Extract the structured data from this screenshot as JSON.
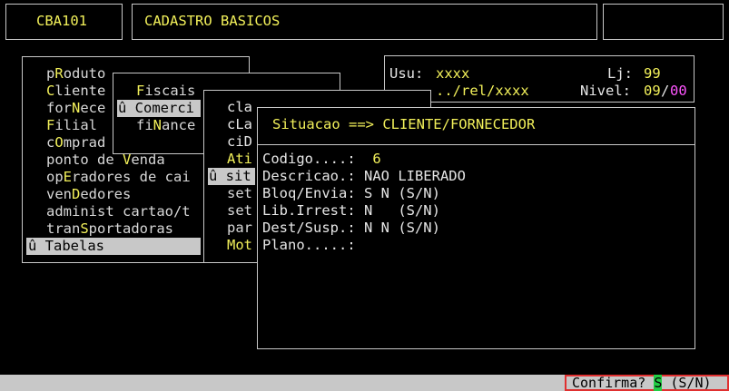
{
  "header": {
    "program_code": "CBA101",
    "screen_title": "CADASTRO BASICOS",
    "right_box": ""
  },
  "session": {
    "user_label": "Usu:",
    "user_value": "xxxx",
    "store_label": "Lj:",
    "store_value": "99",
    "path": "../rel/xxxx",
    "level_label": "Nivel:",
    "level_value": "09",
    "level_sep": "/",
    "level_max": "00"
  },
  "main_menu": {
    "items": [
      {
        "pre": "p",
        "hot": "R",
        "post": "oduto"
      },
      {
        "pre": "",
        "hot": "C",
        "post": "liente"
      },
      {
        "pre": "for",
        "hot": "N",
        "post": "ece"
      },
      {
        "pre": "",
        "hot": "F",
        "post": "ilial"
      },
      {
        "pre": "c",
        "hot": "O",
        "post": "mprad"
      },
      {
        "pre": "ponto de ",
        "hot": "V",
        "post": "enda"
      },
      {
        "pre": "op",
        "hot": "E",
        "post": "radores de cai"
      },
      {
        "pre": "ven",
        "hot": "D",
        "post": "edores"
      },
      {
        "pre": "administ cartao/t",
        "hot": "",
        "post": ""
      },
      {
        "pre": "tran",
        "hot": "S",
        "post": "portadoras"
      }
    ],
    "selected": "û Tabelas"
  },
  "sub_menu": {
    "items": [
      {
        "pre": "",
        "hot": "F",
        "post": "iscais"
      },
      {
        "pre": "",
        "hot": "",
        "post": "û Comerci"
      },
      {
        "pre": "fi",
        "hot": "N",
        "post": "ance"
      }
    ]
  },
  "sub_menu2": {
    "items": [
      {
        "pre": "",
        "hot": "cla",
        "post": ""
      },
      {
        "pre": "",
        "hot": "cLa",
        "post": ""
      },
      {
        "pre": "",
        "hot": "ciD",
        "post": ""
      },
      {
        "pre": "",
        "hot": "Ati",
        "post": ""
      },
      {
        "pre": "",
        "hot": "",
        "post": "û sit"
      },
      {
        "pre": "set",
        "hot": "",
        "post": ""
      },
      {
        "pre": "set",
        "hot": "",
        "post": ""
      },
      {
        "pre": "par",
        "hot": "",
        "post": ""
      },
      {
        "pre": "",
        "hot": "Mot",
        "post": ""
      }
    ]
  },
  "form": {
    "title": "Situacao ==> CLIENTE/FORNECEDOR",
    "fields": [
      {
        "label": "Codigo....:",
        "value": "  6"
      },
      {
        "label": "Descricao.:",
        "value": " NAO LIBERADO"
      },
      {
        "label": "Bloq/Envia:",
        "value": " S N (S/N)"
      },
      {
        "label": "Lib.Irrest:",
        "value": " N   (S/N)"
      },
      {
        "label": "Dest/Susp.:",
        "value": " N N (S/N)"
      },
      {
        "label": "Plano.....:",
        "value": ""
      }
    ]
  },
  "status_bar": {
    "confirm_label": "Confirma?",
    "confirm_value": "S",
    "confirm_options": "(S/N)"
  }
}
